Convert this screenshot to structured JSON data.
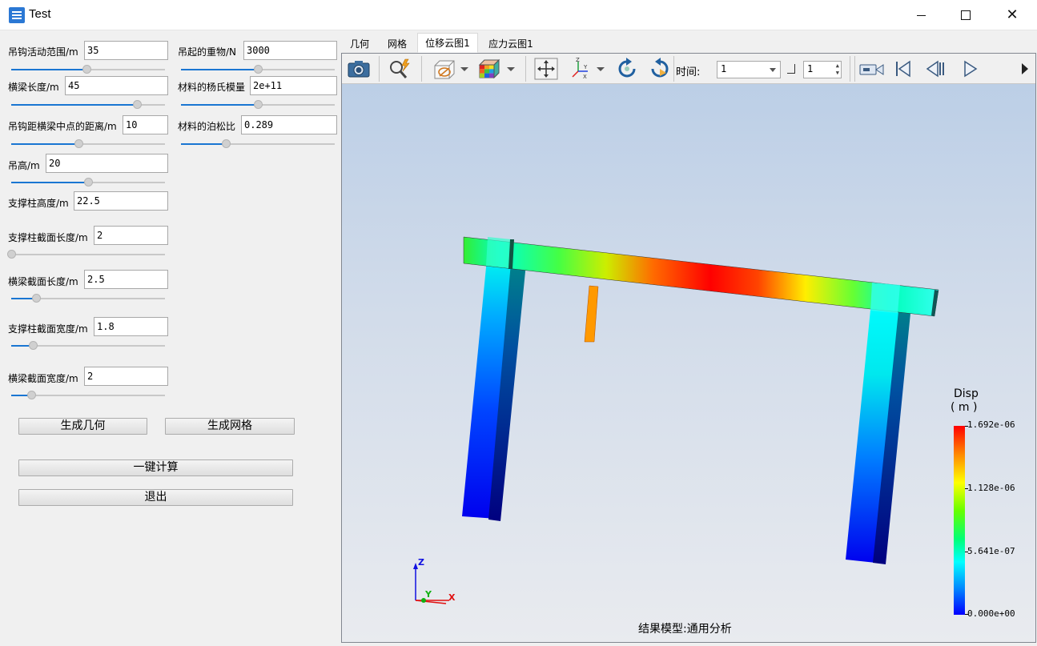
{
  "window": {
    "title": "Test"
  },
  "params": {
    "hook_range_label": "吊钩活动范围/m",
    "hook_range_value": "35",
    "beam_length_label": "横梁长度/m",
    "beam_length_value": "45",
    "hook_offset_label": "吊钩距横梁中点的距离/m",
    "hook_offset_value": "10",
    "lift_height_label": "吊高/m",
    "lift_height_value": "20",
    "column_height_label": "支撑柱高度/m",
    "column_height_value": "22.5",
    "column_section_length_label": "支撑柱截面长度/m",
    "column_section_length_value": "2",
    "beam_section_length_label": "横梁截面长度/m",
    "beam_section_length_value": "2.5",
    "column_section_width_label": "支撑柱截面宽度/m",
    "column_section_width_value": "1.8",
    "beam_section_width_label": "横梁截面宽度/m",
    "beam_section_width_value": "2",
    "load_label": "吊起的重物/N",
    "load_value": "3000",
    "young_label": "材料的杨氏模量",
    "young_value": "2e+11",
    "poisson_label": "材料的泊松比",
    "poisson_value": "0.289"
  },
  "sliders": {
    "hook_range": 0.49,
    "beam_length": 0.82,
    "hook_offset": 0.44,
    "lift_height": 0.5,
    "column_section_length": 0.0,
    "beam_section_length": 0.16,
    "column_section_width": 0.14,
    "beam_section_width": 0.13,
    "load": 0.5,
    "young": 0.5,
    "poisson": 0.29
  },
  "buttons": {
    "gen_geometry": "生成几何",
    "gen_mesh": "生成网格",
    "compute": "一键计算",
    "exit": "退出"
  },
  "tabs": [
    {
      "label": "几何",
      "active": false
    },
    {
      "label": "网格",
      "active": false
    },
    {
      "label": "位移云图1",
      "active": true
    },
    {
      "label": "应力云图1",
      "active": false
    }
  ],
  "toolbar": {
    "time_label": "时间:",
    "time_value": "1",
    "step_value": "1",
    "icons": [
      "camera-icon",
      "zoom-fit-icon",
      "render-mode-icon",
      "colormap-icon",
      "pan-icon",
      "axes-orientation-icon",
      "rotate-cw-icon",
      "rotate-ccw-icon",
      "record-icon",
      "first-frame-icon",
      "prev-frame-icon",
      "play-icon"
    ]
  },
  "viewer": {
    "model_label": "结果模型:通用分析",
    "legend": {
      "title": "Disp",
      "unit": "( m )",
      "max": "1.692e-06",
      "mid_high": "1.128e-06",
      "mid_low": "5.641e-07",
      "min": "0.000e+00",
      "colors": [
        "#ff0000",
        "#ffff00",
        "#00ff00",
        "#00ffff",
        "#0000ff"
      ]
    },
    "triad": {
      "z": "Z",
      "y": "Y",
      "x": "X"
    }
  }
}
